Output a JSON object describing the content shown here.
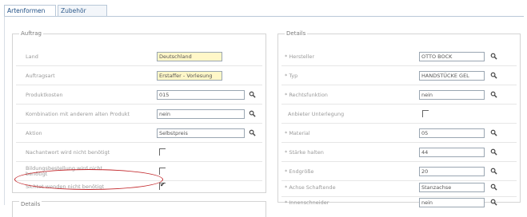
{
  "tabs": [
    {
      "label": "Artenformen",
      "active": true
    },
    {
      "label": "Zubehör",
      "active": false
    }
  ],
  "left_panel": {
    "legend": "Auftrag",
    "rows": [
      {
        "label": "Land",
        "type": "field",
        "value": "Deutschland",
        "style": "yellow",
        "lookup": false
      },
      {
        "label": "Auftragsart",
        "type": "field",
        "value": "Erstaffer - Vorlesung",
        "style": "yellow",
        "lookup": false
      },
      {
        "label": "Produktkosten",
        "type": "field",
        "value": "015",
        "style": "white",
        "lookup": true
      },
      {
        "label": "Kombination mit anderem alten Produkt",
        "type": "field",
        "value": "nein",
        "style": "white",
        "lookup": true
      },
      {
        "label": "Aktion",
        "type": "field",
        "value": "Selbstpreis",
        "style": "white",
        "lookup": true
      },
      {
        "label": "Nachantwort wird nicht benötigt",
        "type": "checkbox",
        "checked": false
      },
      {
        "label": "Bildungsbestellung wird nicht benötigt",
        "type": "checkbox",
        "checked": false
      },
      {
        "label": "Sichtet wenden nicht benötigt",
        "type": "checkbox",
        "checked": true
      }
    ],
    "bottom_legend": "Details"
  },
  "right_panel": {
    "legend": "Details",
    "rows": [
      {
        "label": "* Hersteller",
        "type": "field",
        "value": "OTTO BOCK",
        "lookup": true
      },
      {
        "label": "* Typ",
        "type": "field",
        "value": "HANDSTÜCKE GEL",
        "lookup": true
      },
      {
        "label": "* Rechtsfunktion",
        "type": "field",
        "value": "nein",
        "lookup": true
      },
      {
        "label": "Anbieter Unterlegung",
        "type": "checkbox",
        "checked": false
      },
      {
        "label": "* Material",
        "type": "field",
        "value": "05",
        "lookup": true
      },
      {
        "label": "* Stärke halten",
        "type": "field",
        "value": "44",
        "lookup": true
      },
      {
        "label": "* Endgröße",
        "type": "field",
        "value": "20",
        "lookup": true
      },
      {
        "label": "* Achse Schaftende",
        "type": "field",
        "value": "Stanzachse",
        "lookup": true
      },
      {
        "label": "* Innenschneider",
        "type": "field",
        "value": "nein",
        "lookup": true
      }
    ]
  },
  "colors": {
    "highlight_oval": "#c2262a",
    "yellow_field": "#fff7c8",
    "tab_text": "#1f4f86"
  },
  "icons": {
    "lookup": "magnifier-icon"
  }
}
